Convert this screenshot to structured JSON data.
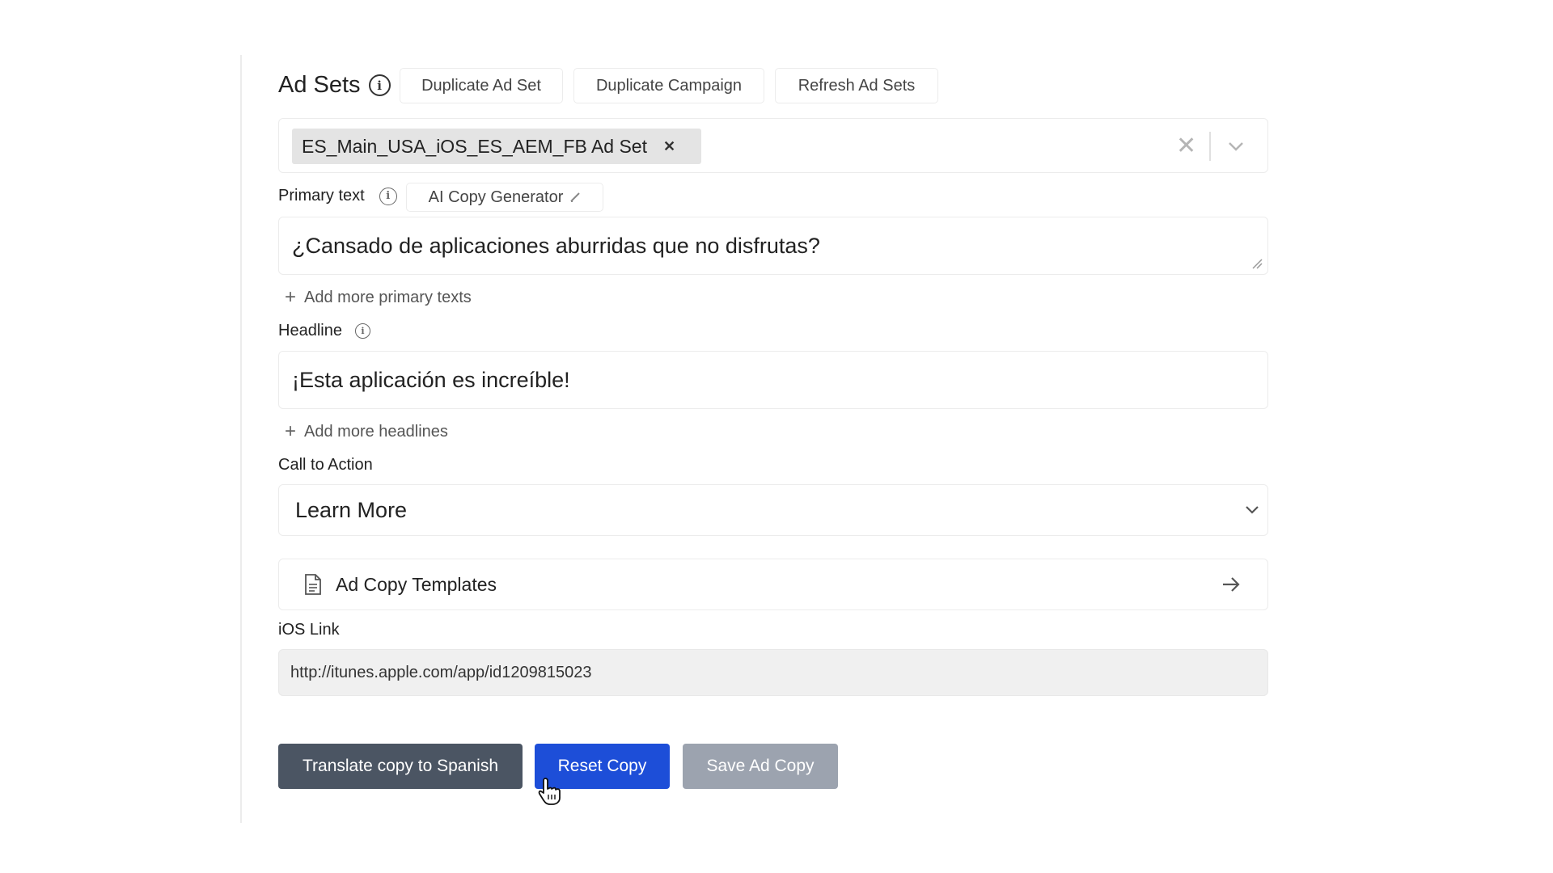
{
  "header": {
    "title": "Ad Sets",
    "buttons": {
      "duplicate_ad_set": "Duplicate Ad Set",
      "duplicate_campaign": "Duplicate Campaign",
      "refresh_ad_sets": "Refresh Ad Sets"
    }
  },
  "ad_set_select": {
    "selected_chip": "ES_Main_USA_iOS_ES_AEM_FB Ad Set"
  },
  "primary_text": {
    "label": "Primary text",
    "ai_button": "AI Copy Generator",
    "value": "¿Cansado de aplicaciones aburridas que no disfrutas?",
    "add_more": "Add more primary texts"
  },
  "headline": {
    "label": "Headline",
    "value": "¡Esta aplicación es increíble!",
    "add_more": "Add more headlines"
  },
  "call_to_action": {
    "label": "Call to Action",
    "value": "Learn More"
  },
  "templates": {
    "label": "Ad Copy Templates"
  },
  "ios_link": {
    "label": "iOS Link",
    "value": "http://itunes.apple.com/app/id1209815023"
  },
  "actions": {
    "translate": "Translate copy to Spanish",
    "reset": "Reset Copy",
    "save": "Save Ad Copy"
  },
  "colors": {
    "translate_bg": "#4b5563",
    "reset_bg": "#1d4ed8",
    "save_bg": "#9ca3af"
  },
  "icons": [
    "info-icon",
    "close-icon",
    "chevron-down-icon",
    "pencil-icon",
    "plus-icon",
    "document-icon",
    "arrow-right-icon",
    "hand-cursor-icon"
  ]
}
